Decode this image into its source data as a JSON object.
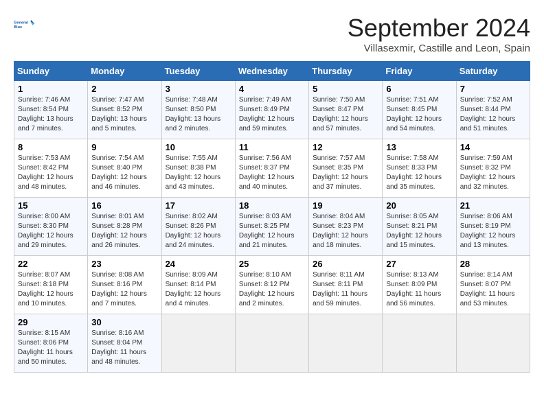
{
  "logo": {
    "line1": "General",
    "line2": "Blue"
  },
  "title": "September 2024",
  "subtitle": "Villasexmir, Castille and Leon, Spain",
  "days_header": [
    "Sunday",
    "Monday",
    "Tuesday",
    "Wednesday",
    "Thursday",
    "Friday",
    "Saturday"
  ],
  "weeks": [
    [
      {
        "day": "1",
        "info": "Sunrise: 7:46 AM\nSunset: 8:54 PM\nDaylight: 13 hours\nand 7 minutes."
      },
      {
        "day": "2",
        "info": "Sunrise: 7:47 AM\nSunset: 8:52 PM\nDaylight: 13 hours\nand 5 minutes."
      },
      {
        "day": "3",
        "info": "Sunrise: 7:48 AM\nSunset: 8:50 PM\nDaylight: 13 hours\nand 2 minutes."
      },
      {
        "day": "4",
        "info": "Sunrise: 7:49 AM\nSunset: 8:49 PM\nDaylight: 12 hours\nand 59 minutes."
      },
      {
        "day": "5",
        "info": "Sunrise: 7:50 AM\nSunset: 8:47 PM\nDaylight: 12 hours\nand 57 minutes."
      },
      {
        "day": "6",
        "info": "Sunrise: 7:51 AM\nSunset: 8:45 PM\nDaylight: 12 hours\nand 54 minutes."
      },
      {
        "day": "7",
        "info": "Sunrise: 7:52 AM\nSunset: 8:44 PM\nDaylight: 12 hours\nand 51 minutes."
      }
    ],
    [
      {
        "day": "8",
        "info": "Sunrise: 7:53 AM\nSunset: 8:42 PM\nDaylight: 12 hours\nand 48 minutes."
      },
      {
        "day": "9",
        "info": "Sunrise: 7:54 AM\nSunset: 8:40 PM\nDaylight: 12 hours\nand 46 minutes."
      },
      {
        "day": "10",
        "info": "Sunrise: 7:55 AM\nSunset: 8:38 PM\nDaylight: 12 hours\nand 43 minutes."
      },
      {
        "day": "11",
        "info": "Sunrise: 7:56 AM\nSunset: 8:37 PM\nDaylight: 12 hours\nand 40 minutes."
      },
      {
        "day": "12",
        "info": "Sunrise: 7:57 AM\nSunset: 8:35 PM\nDaylight: 12 hours\nand 37 minutes."
      },
      {
        "day": "13",
        "info": "Sunrise: 7:58 AM\nSunset: 8:33 PM\nDaylight: 12 hours\nand 35 minutes."
      },
      {
        "day": "14",
        "info": "Sunrise: 7:59 AM\nSunset: 8:32 PM\nDaylight: 12 hours\nand 32 minutes."
      }
    ],
    [
      {
        "day": "15",
        "info": "Sunrise: 8:00 AM\nSunset: 8:30 PM\nDaylight: 12 hours\nand 29 minutes."
      },
      {
        "day": "16",
        "info": "Sunrise: 8:01 AM\nSunset: 8:28 PM\nDaylight: 12 hours\nand 26 minutes."
      },
      {
        "day": "17",
        "info": "Sunrise: 8:02 AM\nSunset: 8:26 PM\nDaylight: 12 hours\nand 24 minutes."
      },
      {
        "day": "18",
        "info": "Sunrise: 8:03 AM\nSunset: 8:25 PM\nDaylight: 12 hours\nand 21 minutes."
      },
      {
        "day": "19",
        "info": "Sunrise: 8:04 AM\nSunset: 8:23 PM\nDaylight: 12 hours\nand 18 minutes."
      },
      {
        "day": "20",
        "info": "Sunrise: 8:05 AM\nSunset: 8:21 PM\nDaylight: 12 hours\nand 15 minutes."
      },
      {
        "day": "21",
        "info": "Sunrise: 8:06 AM\nSunset: 8:19 PM\nDaylight: 12 hours\nand 13 minutes."
      }
    ],
    [
      {
        "day": "22",
        "info": "Sunrise: 8:07 AM\nSunset: 8:18 PM\nDaylight: 12 hours\nand 10 minutes."
      },
      {
        "day": "23",
        "info": "Sunrise: 8:08 AM\nSunset: 8:16 PM\nDaylight: 12 hours\nand 7 minutes."
      },
      {
        "day": "24",
        "info": "Sunrise: 8:09 AM\nSunset: 8:14 PM\nDaylight: 12 hours\nand 4 minutes."
      },
      {
        "day": "25",
        "info": "Sunrise: 8:10 AM\nSunset: 8:12 PM\nDaylight: 12 hours\nand 2 minutes."
      },
      {
        "day": "26",
        "info": "Sunrise: 8:11 AM\nSunset: 8:11 PM\nDaylight: 11 hours\nand 59 minutes."
      },
      {
        "day": "27",
        "info": "Sunrise: 8:13 AM\nSunset: 8:09 PM\nDaylight: 11 hours\nand 56 minutes."
      },
      {
        "day": "28",
        "info": "Sunrise: 8:14 AM\nSunset: 8:07 PM\nDaylight: 11 hours\nand 53 minutes."
      }
    ],
    [
      {
        "day": "29",
        "info": "Sunrise: 8:15 AM\nSunset: 8:06 PM\nDaylight: 11 hours\nand 50 minutes."
      },
      {
        "day": "30",
        "info": "Sunrise: 8:16 AM\nSunset: 8:04 PM\nDaylight: 11 hours\nand 48 minutes."
      },
      {
        "day": "",
        "info": ""
      },
      {
        "day": "",
        "info": ""
      },
      {
        "day": "",
        "info": ""
      },
      {
        "day": "",
        "info": ""
      },
      {
        "day": "",
        "info": ""
      }
    ]
  ]
}
